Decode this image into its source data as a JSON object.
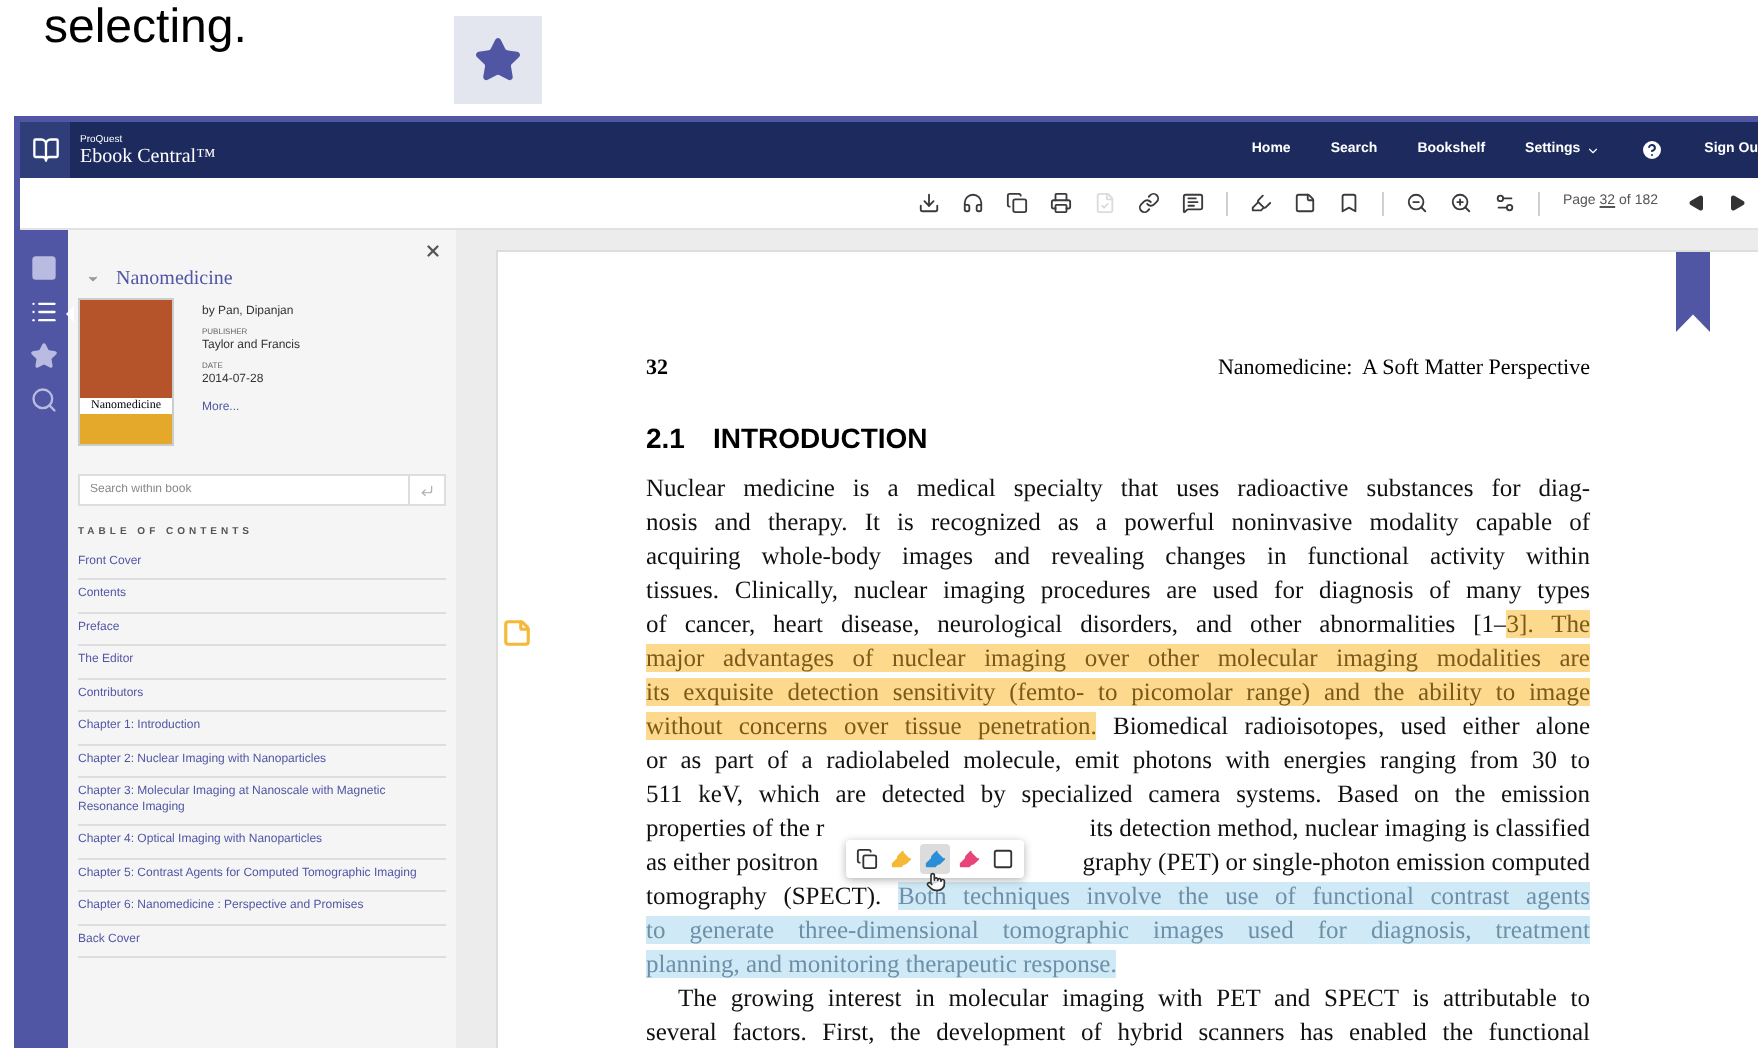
{
  "intro_text": "selecting.",
  "header": {
    "brand_small": "ProQuest",
    "brand": "Ebook Central™",
    "nav": [
      "Home",
      "Search",
      "Bookshelf",
      "Settings"
    ],
    "sign_out": "Sign Ou"
  },
  "toolbar": {
    "groups": [
      [
        {
          "kind": "download",
          "disabled": false
        },
        {
          "kind": "audio",
          "disabled": false
        },
        {
          "kind": "copy",
          "disabled": false
        },
        {
          "kind": "print",
          "disabled": false
        },
        {
          "kind": "export",
          "disabled": true
        },
        {
          "kind": "link",
          "disabled": false
        },
        {
          "kind": "comment",
          "disabled": false
        }
      ],
      [
        {
          "kind": "highlight",
          "disabled": false
        },
        {
          "kind": "note",
          "disabled": false
        },
        {
          "kind": "bookmark",
          "disabled": false
        }
      ],
      [
        {
          "kind": "zoom-out",
          "disabled": false
        },
        {
          "kind": "zoom-in",
          "disabled": false
        },
        {
          "kind": "fit",
          "disabled": false
        }
      ]
    ],
    "page_prefix": "Page",
    "page_current": "32",
    "page_suffix": "of 182"
  },
  "rail": [
    {
      "kind": "pages",
      "selected": false
    },
    {
      "kind": "contents",
      "selected": true
    },
    {
      "kind": "bookmarks",
      "selected": false
    },
    {
      "kind": "search",
      "selected": false
    }
  ],
  "panel": {
    "book_title": "Nanomedicine",
    "author": "by Pan, Dipanjan",
    "publisher_label": "PUBLISHER",
    "publisher": "Taylor and Francis",
    "date_label": "DATE",
    "date": "2014-07-28",
    "more_link": "More...",
    "cover_title": "Nanomedicine",
    "search": {
      "placeholder": "Search within book"
    },
    "toc_heading": "TABLE OF CONTENTS",
    "toc": [
      "Front Cover",
      "Contents",
      "Preface",
      "The Editor",
      "Contributors",
      "Chapter 1: Introduction",
      "Chapter 2: Nuclear Imaging with Nanoparticles",
      "Chapter 3: Molecular Imaging at Nanoscale with Magnetic Resonance Imaging",
      "Chapter 4: Optical Imaging with Nanoparticles",
      "Chapter 5: Contrast Agents for Computed Tomographic Imaging",
      "Chapter 6: Nanomedicine : Perspective and Promises",
      "Back Cover"
    ]
  },
  "page": {
    "bookmarked": true,
    "number": "32",
    "running_head": "Nanomedicine:  A Soft Matter Perspective",
    "heading_number": "2.1",
    "heading": "INTRODUCTION",
    "paragraphs": [
      {
        "complete": true,
        "lines": [
          [
            [
              {
                "text": "Nuclear medicine is a medical specialty that uses radioactive substances for diag-"
              }
            ]
          ],
          [
            [
              {
                "text": "nosis and therapy. It is recognized as a powerful noninvasive modality capable of"
              }
            ]
          ],
          [
            [
              {
                "text": "acquiring whole-body images and revealing changes in functional activity within"
              }
            ]
          ],
          [
            [
              {
                "text": "tissues. Clinically, nuclear imaging procedures are used for diagnosis of many types"
              }
            ]
          ],
          [
            [
              {
                "text": "of cancer, heart disease, neurological disorders, and other abnormalities [1–"
              },
              {
                "text": "3]. The",
                "color": "#fcd98c"
              }
            ]
          ],
          [
            [
              {
                "text": "major advantages of nuclear imaging over other molecular imaging modalities are",
                "color": "#fcd98c"
              }
            ]
          ],
          [
            [
              {
                "text": "its exquisite detection sensitivity (femto- to picomolar range) and the ability to image",
                "color": "#fcd98c"
              }
            ]
          ],
          [
            [
              {
                "text": "without concerns over tissue penetration.",
                "color": "#fcd98c"
              },
              {
                "text": " Biomedical radioisotopes, used either alone"
              }
            ]
          ],
          [
            [
              {
                "text": "or as part of a radiolabeled molecule, emit photons with energies ranging from 30 to"
              }
            ]
          ],
          [
            [
              {
                "text": "511 keV, which are detected by specialized camera systems. Based on the emission"
              }
            ]
          ],
          [
            [
              {
                "text": "properties of the r"
              }
            ],
            [
              {
                "text": "its detection method, nuclear imaging is classified"
              }
            ]
          ],
          [
            [
              {
                "text": "as either positron"
              }
            ],
            [
              {
                "text": "graphy (PET) or single-photon emission computed"
              }
            ]
          ],
          [
            [
              {
                "text": "tomography (SPECT). "
              },
              {
                "text": "Both techniques involve the use of functional contrast agents",
                "color": "#cfeaf6"
              }
            ]
          ],
          [
            [
              {
                "text": "to generate three-dimensional tomographic images used for diagnosis, treatment",
                "color": "#cfeaf6"
              }
            ]
          ],
          [
            [
              {
                "text": "planning, and monitoring therapeutic response.",
                "color": "#cfeaf6"
              }
            ]
          ]
        ]
      },
      {
        "complete": false,
        "lines": [
          [
            [
              {
                "text": "The growing interest in molecular imaging with PET and SPECT is attributable to"
              }
            ]
          ],
          [
            [
              {
                "text": "several factors. First, the development of hybrid scanners has enabled the functional"
              }
            ]
          ]
        ]
      }
    ]
  },
  "popup": [
    {
      "kind": "copy",
      "selected": false
    },
    {
      "kind": "highlight",
      "color": "#f5b936",
      "selected": false
    },
    {
      "kind": "highlight",
      "color": "#2a8fd8",
      "selected": true
    },
    {
      "kind": "highlight",
      "color": "#e8457a",
      "selected": false
    },
    {
      "kind": "note",
      "selected": false
    }
  ]
}
